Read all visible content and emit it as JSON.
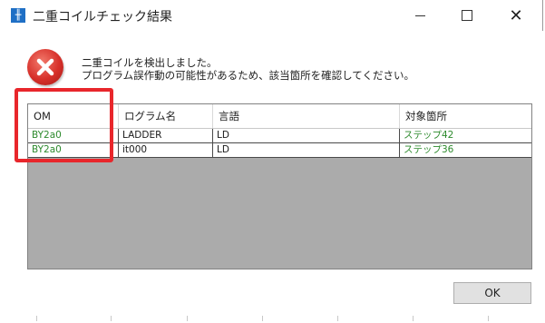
{
  "window": {
    "icon": "ladder-app-icon",
    "icon_glyph": "╫",
    "title": "二重コイルチェック結果",
    "controls": {
      "minimize": "minimize-icon",
      "maximize": "maximize-icon",
      "close": "close-icon",
      "close_glyph": "✕"
    }
  },
  "message": {
    "icon": "error-icon",
    "line1": "二重コイルを検出しました。",
    "line2": "プログラム誤作動の可能性があるため、該当箇所を確認してください。"
  },
  "table": {
    "columns": [
      "OM",
      "ログラム名",
      "言語",
      "対象箇所"
    ],
    "rows": [
      [
        "BY2a0",
        "LADDER",
        "LD",
        "ステップ42"
      ],
      [
        "BY2a0",
        "it000",
        "LD",
        "ステップ36"
      ]
    ]
  },
  "annotation": {
    "highlight_color": "#e8262b"
  },
  "buttons": {
    "ok": "OK"
  }
}
